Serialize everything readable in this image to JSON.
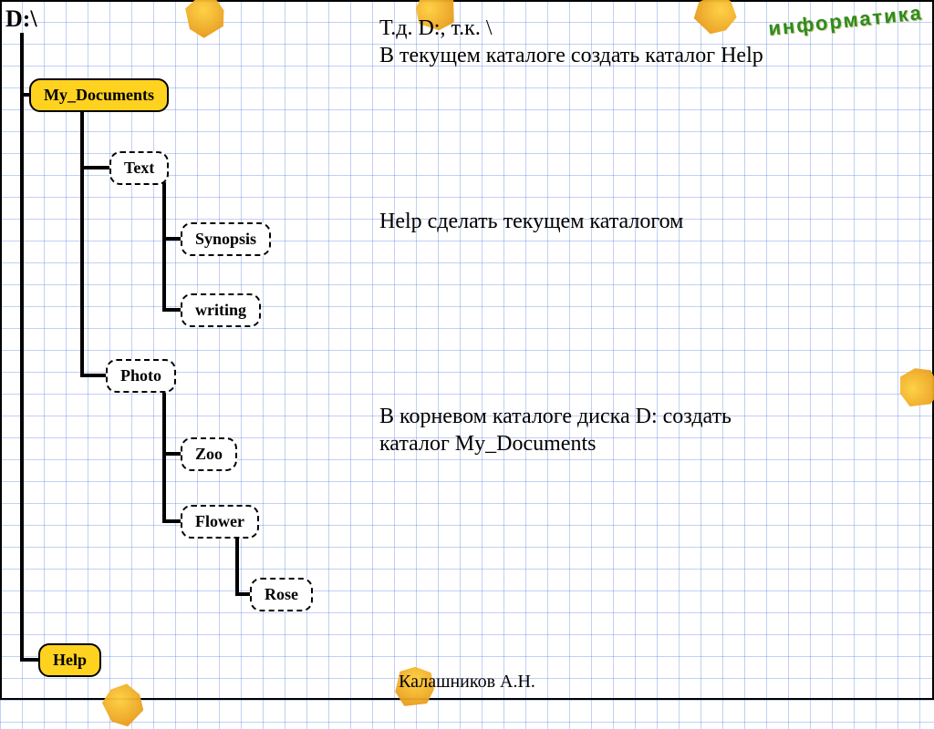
{
  "root": "D:\\",
  "watermark": "информатика",
  "author": "Калашников А.Н.",
  "nodes": {
    "my_documents": "My_Documents",
    "text": "Text",
    "synopsis": "Synopsis",
    "writing": "writing",
    "photo": "Photo",
    "zoo": "Zoo",
    "flower": "Flower",
    "rose": "Rose",
    "help": "Help"
  },
  "tasks": {
    "t1_line1": "Т.д. D:, т.к. \\",
    "t1_line2": "В текущем каталоге создать каталог Help",
    "t2": "Help сделать текущем каталогом",
    "t3_line1": "В корневом каталоге диска D: создать",
    "t3_line2": "каталог My_Documents"
  }
}
